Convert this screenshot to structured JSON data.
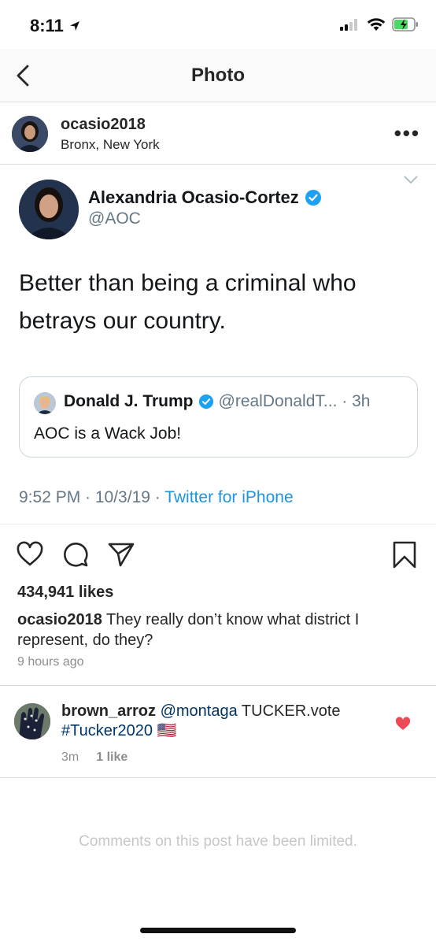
{
  "status": {
    "time": "8:11"
  },
  "nav": {
    "title": "Photo"
  },
  "post": {
    "username": "ocasio2018",
    "location": "Bronx, New York"
  },
  "tweet": {
    "name": "Alexandria Ocasio-Cortez",
    "handle": "@AOC",
    "text": "Better than being a criminal who betrays our country.",
    "quote": {
      "name": "Donald J. Trump",
      "handle": "@realDonaldT... · 3h",
      "text": "AOC is a Wack Job!"
    },
    "timestamp": "9:52 PM · 10/3/19 · ",
    "source": "Twitter for iPhone"
  },
  "likes": "434,941 likes",
  "caption": {
    "username": "ocasio2018",
    "text": " They really don’t know what district I represent, do they?"
  },
  "time_ago": "9 hours ago",
  "comment": {
    "username": "brown_arroz",
    "mention": " @montaga",
    "text": " TUCKER.vote",
    "hashtag": "#Tucker2020",
    "flag": " 🇺🇸",
    "age": "3m",
    "likes": "1 like"
  },
  "comments_limited": "Comments on this post have been limited.",
  "colors": {
    "twitter_blue": "#1b95e0",
    "verified_blue": "#1da1f2",
    "heart_red": "#ed4956",
    "hashtag_blue": "#003569"
  }
}
